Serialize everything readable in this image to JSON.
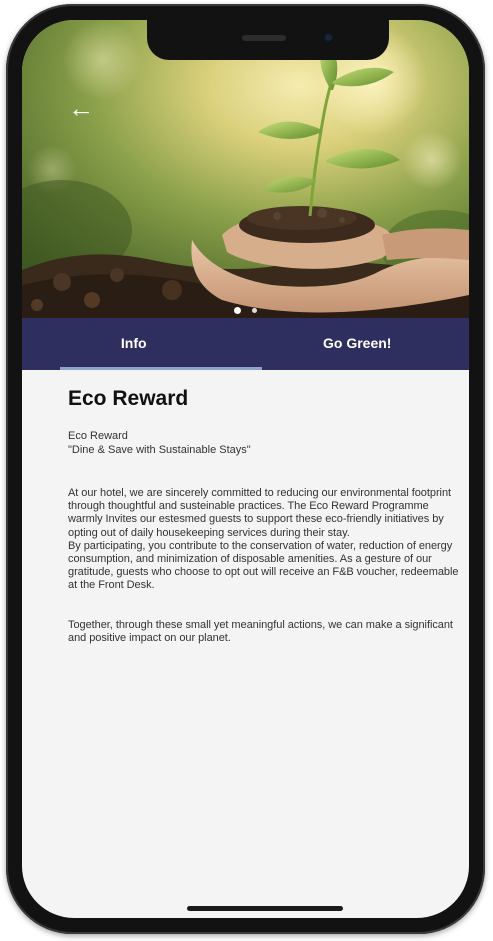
{
  "hero": {
    "back_icon": "arrow-left-icon",
    "carousel": {
      "total_pages": 2,
      "active_page": 1
    }
  },
  "tabs": [
    {
      "label": "Info",
      "active": true
    },
    {
      "label": "Go Green!",
      "active": false
    }
  ],
  "content": {
    "title": "Eco Reward",
    "subtitle": "Eco Reward",
    "tagline": "\"Dine & Save with Sustainable Stays\"",
    "paragraphs": [
      "At our hotel, we are sincerely committed to reducing our environmental footprint through thoughtful and susteinable practices. The Eco Reward Programme warmly Invites our estesmed guests to support these eco-friendly initiatives by opting out of daily housekeeping services during their stay.",
      "By participating, you contribute to the conservation of water, reduction of energy consumption, and minimization of disposable amenities. As a gesture of our gratitude, guests who choose to opt out will receive an F&B voucher, redeemable at the Front Desk.",
      "Together, through these small yet meaningful actions, we can make a significant and positive impact on our planet."
    ]
  },
  "colors": {
    "tab_bar": "#2e2f5e",
    "tab_indicator": "#8fa4c8",
    "content_bg": "#f4f4f4",
    "device_frame": "#121212"
  }
}
